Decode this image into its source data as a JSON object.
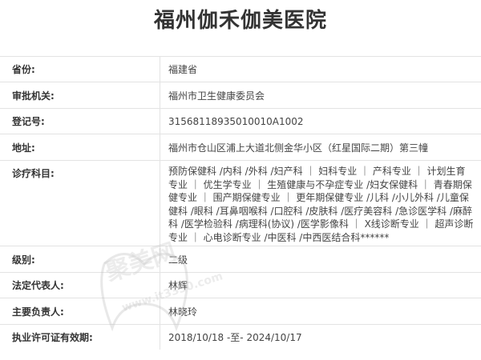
{
  "page": {
    "title": "福州伽禾伽美医院"
  },
  "rows": [
    {
      "label": "省份:",
      "value": "福建省"
    },
    {
      "label": "审批机关:",
      "value": "福州市卫生健康委员会"
    },
    {
      "label": "登记号:",
      "value": "31568118935010010A1002"
    },
    {
      "label": "地址:",
      "value": "福州市仓山区浦上大道北侧金华小区（红星国际二期）第三幢"
    },
    {
      "label": "诊疗科目:",
      "value": "预防保健科 /内科 /外科 /妇产科 ｜ 妇科专业 ｜ 产科专业 ｜ 计划生育专业 ｜ 优生学专业 ｜ 生殖健康与不孕症专业 /妇女保健科 ｜ 青春期保健专业 ｜ 围产期保健专业 ｜ 更年期保健专业 /儿科 /小儿外科 /儿童保健科 /眼科 /耳鼻咽喉科 /口腔科 /皮肤科 /医疗美容科 /急诊医学科 /麻醉科 /医学检验科 /病理科(协议) /医学影像科 ｜ X线诊断专业 ｜ 超声诊断专业 ｜ 心电诊断专业 /中医科 /中西医结合科******"
    },
    {
      "label": "级别:",
      "value": "二级"
    },
    {
      "label": "法定代表人:",
      "value": "林辉"
    },
    {
      "label": "主要负责人:",
      "value": "林晓玲"
    },
    {
      "label": "执业许可证有效期:",
      "value": "2018/10/18 -至- 2024/10/17"
    }
  ],
  "watermark": {
    "text": "聚美网",
    "url": "www.it3330.com"
  }
}
